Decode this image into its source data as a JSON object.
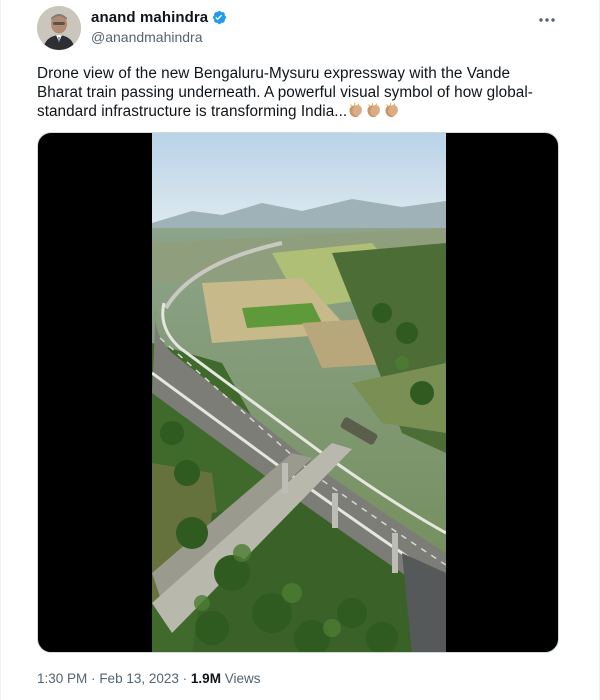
{
  "author": {
    "display_name": "anand mahindra",
    "handle": "@anandmahindra",
    "verified": true,
    "avatar_icon": "profile-photo",
    "verified_color": "#1d9bf0"
  },
  "tweet": {
    "text": "Drone view of the new Bengaluru-Mysuru expressway with the Vande Bharat train passing underneath. A powerful visual symbol of how global-standard infrastructure is transforming India...",
    "emoji": [
      "clapping-hands-emoji",
      "clapping-hands-emoji",
      "clapping-hands-emoji"
    ]
  },
  "media": {
    "type": "video",
    "description_icon": "aerial-expressway-video"
  },
  "footer": {
    "time": "1:30 PM",
    "separator": "·",
    "date": "Feb 13, 2023",
    "views_count": "1.9M",
    "views_label": "Views"
  },
  "colors": {
    "text_primary": "#0f1419",
    "text_secondary": "#536471",
    "border": "#cfd9de"
  }
}
